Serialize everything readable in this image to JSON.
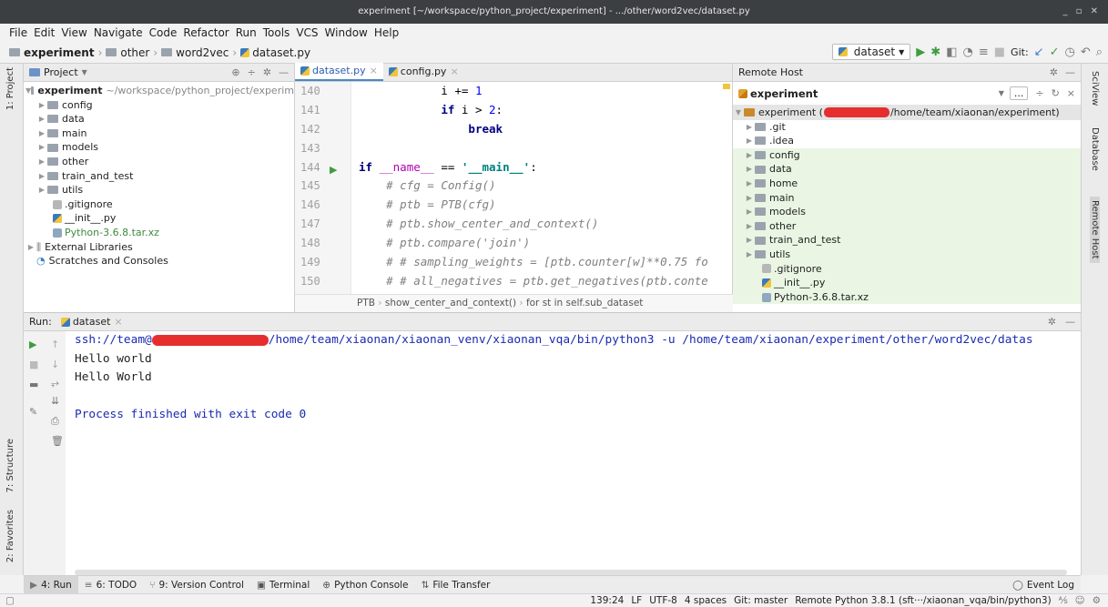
{
  "window_title": "experiment [~/workspace/python_project/experiment] - .../other/word2vec/dataset.py",
  "window_controls": "_ ▫ ✕",
  "menu": [
    "File",
    "Edit",
    "View",
    "Navigate",
    "Code",
    "Refactor",
    "Run",
    "Tools",
    "VCS",
    "Window",
    "Help"
  ],
  "breadcrumb": [
    "experiment",
    "other",
    "word2vec",
    "dataset.py"
  ],
  "toolbar": {
    "run_config": "dataset",
    "git_label": "Git:"
  },
  "left_strip": {
    "project": "1: Project",
    "structure": "7: Structure",
    "favorites": "2: Favorites"
  },
  "right_strip": {
    "sciview": "SciView",
    "database": "Database",
    "remote_host": "Remote Host"
  },
  "project_panel": {
    "title": "Project",
    "root_name": "experiment",
    "root_path": "~/workspace/python_project/experim",
    "items": [
      {
        "label": "config",
        "type": "folder"
      },
      {
        "label": "data",
        "type": "folder"
      },
      {
        "label": "main",
        "type": "folder"
      },
      {
        "label": "models",
        "type": "folder"
      },
      {
        "label": "other",
        "type": "folder"
      },
      {
        "label": "train_and_test",
        "type": "folder"
      },
      {
        "label": "utils",
        "type": "folder"
      },
      {
        "label": ".gitignore",
        "type": "file"
      },
      {
        "label": "__init__.py",
        "type": "file"
      },
      {
        "label": "Python-3.6.8.tar.xz",
        "type": "archive"
      }
    ],
    "external": "External Libraries",
    "scratches": "Scratches and Consoles"
  },
  "editor": {
    "tabs": [
      {
        "label": "dataset.py",
        "active": true
      },
      {
        "label": "config.py",
        "active": false
      }
    ],
    "line_numbers": [
      "140",
      "141",
      "142",
      "143",
      "144",
      "145",
      "146",
      "147",
      "148",
      "149",
      "150"
    ],
    "breadcrumb": [
      "PTB",
      "show_center_and_context()",
      "for st in self.sub_dataset"
    ]
  },
  "remote_host": {
    "title": "Remote Host",
    "server": "experiment",
    "root_name": "experiment (",
    "root_path": "/home/team/xiaonan/experiment)",
    "folders": [
      ".git",
      ".idea",
      "config",
      "data",
      "home",
      "main",
      "models",
      "other",
      "train_and_test",
      "utils"
    ],
    "files": [
      ".gitignore",
      "__init__.py",
      "Python-3.6.8.tar.xz"
    ]
  },
  "run": {
    "label": "Run:",
    "tab": "dataset",
    "command_prefix": "ssh://team@",
    "command_suffix": "/home/team/xiaonan/xiaonan_venv/xiaonan_vqa/bin/python3 -u /home/team/xiaonan/experiment/other/word2vec/datas",
    "output": [
      "Hello world",
      "Hello World",
      "",
      "Process finished with exit code 0"
    ]
  },
  "bottom_tabs": [
    {
      "label": "4: Run",
      "active": true
    },
    {
      "label": "6: TODO",
      "active": false
    },
    {
      "label": "9: Version Control",
      "active": false
    },
    {
      "label": "Terminal",
      "active": false
    },
    {
      "label": "Python Console",
      "active": false
    },
    {
      "label": "File Transfer",
      "active": false
    }
  ],
  "event_log": "Event Log",
  "status": {
    "position": "139:24",
    "line_sep": "LF",
    "encoding": "UTF-8",
    "indent": "4 spaces",
    "git": "Git: master",
    "interpreter": "Remote Python 3.8.1 (sft···/xiaonan_vqa/bin/python3)"
  }
}
